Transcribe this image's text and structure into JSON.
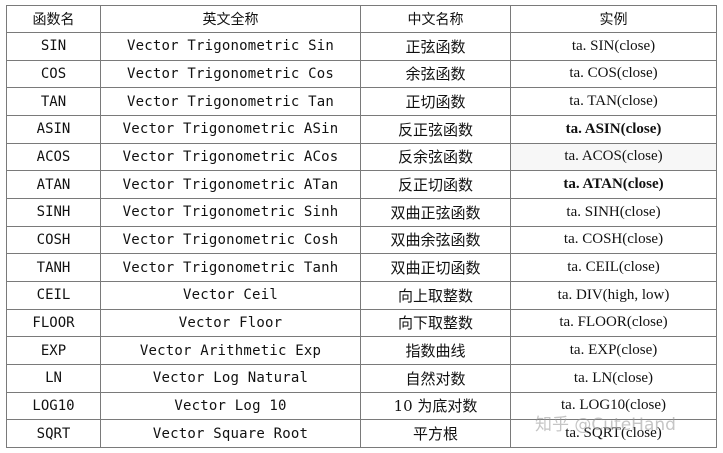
{
  "table": {
    "headers": [
      "函数名",
      "英文全称",
      "中文名称",
      "实例"
    ],
    "rows": [
      {
        "fn": "SIN",
        "en": "Vector Trigonometric Sin",
        "cn": "正弦函数",
        "ex": "ta. SIN(close)"
      },
      {
        "fn": "COS",
        "en": "Vector Trigonometric Cos",
        "cn": "余弦函数",
        "ex": "ta. COS(close)"
      },
      {
        "fn": "TAN",
        "en": "Vector Trigonometric Tan",
        "cn": "正切函数",
        "ex": "ta. TAN(close)"
      },
      {
        "fn": "ASIN",
        "en": "Vector Trigonometric ASin",
        "cn": "反正弦函数",
        "ex": "ta. ASIN(close)"
      },
      {
        "fn": "ACOS",
        "en": "Vector Trigonometric ACos",
        "cn": "反余弦函数",
        "ex": "ta. ACOS(close)"
      },
      {
        "fn": "ATAN",
        "en": "Vector Trigonometric ATan",
        "cn": "反正切函数",
        "ex": "ta. ATAN(close)"
      },
      {
        "fn": "SINH",
        "en": "Vector Trigonometric Sinh",
        "cn": "双曲正弦函数",
        "ex": "ta. SINH(close)"
      },
      {
        "fn": "COSH",
        "en": "Vector Trigonometric Cosh",
        "cn": "双曲余弦函数",
        "ex": "ta. COSH(close)"
      },
      {
        "fn": "TANH",
        "en": "Vector Trigonometric Tanh",
        "cn": "双曲正切函数",
        "ex": "ta. CEIL(close)"
      },
      {
        "fn": "CEIL",
        "en": "Vector Ceil",
        "cn": "向上取整数",
        "ex": "ta. DIV(high, low)"
      },
      {
        "fn": "FLOOR",
        "en": "Vector Floor",
        "cn": "向下取整数",
        "ex": "ta. FLOOR(close)"
      },
      {
        "fn": "EXP",
        "en": "Vector Arithmetic Exp",
        "cn": "指数曲线",
        "ex": "ta. EXP(close)"
      },
      {
        "fn": "LN",
        "en": "Vector Log Natural",
        "cn": "自然对数",
        "ex": "ta. LN(close)"
      },
      {
        "fn": "LOG10",
        "en": "Vector Log 10",
        "cn": "10 为底对数",
        "ex": "ta. LOG10(close)"
      },
      {
        "fn": "SQRT",
        "en": "Vector Square Root",
        "cn": "平方根",
        "ex": "ta. SQRT(close)"
      }
    ]
  },
  "watermark": "知乎 @CuteHand"
}
